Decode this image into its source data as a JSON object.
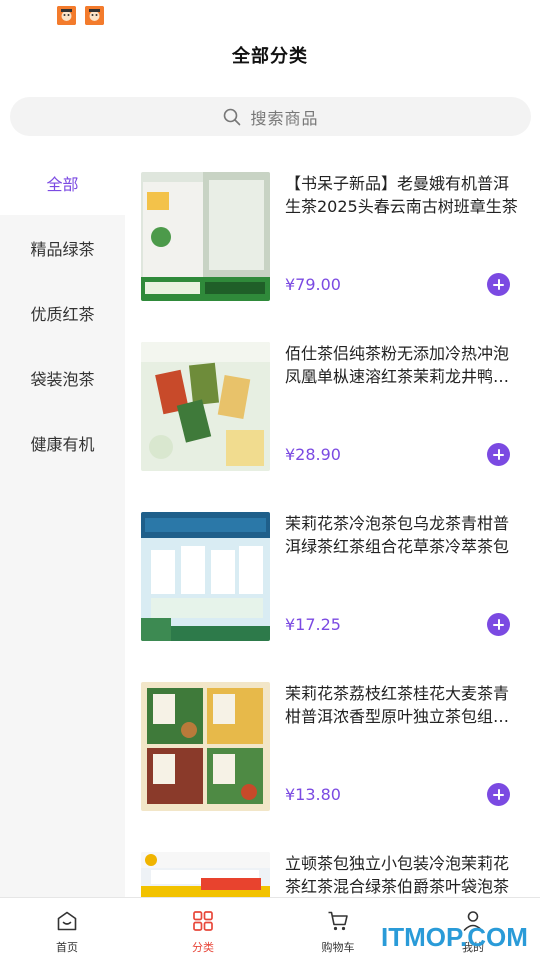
{
  "status_bar": {
    "icons": [
      "app-notification-icon",
      "app-notification-icon"
    ]
  },
  "header": {
    "title": "全部分类"
  },
  "search": {
    "placeholder": "搜索商品"
  },
  "sidebar": {
    "items": [
      {
        "label": "全部",
        "active": true
      },
      {
        "label": "精品绿茶",
        "active": false
      },
      {
        "label": "优质红茶",
        "active": false
      },
      {
        "label": "袋装泡茶",
        "active": false
      },
      {
        "label": "健康有机",
        "active": false
      }
    ]
  },
  "products": [
    {
      "title": "【书呆子新品】老曼娥有机普洱生茶2025头春云南古树班章生茶",
      "price": "¥79.00"
    },
    {
      "title": "佰仕茶侣纯茶粉无添加冷热冲泡凤凰单枞速溶红茶茉莉龙井鸭屎香",
      "price": "¥28.90"
    },
    {
      "title": "茉莉花茶冷泡茶包乌龙茶青柑普洱绿茶红茶组合花草茶冷萃茶包",
      "price": "¥17.25"
    },
    {
      "title": "茉莉花茶荔枝红茶桂花大麦茶青柑普洱浓香型原叶独立茶包组合装",
      "price": "¥13.80"
    },
    {
      "title": "立顿茶包独立小包装冷泡茉莉花茶红茶混合绿茶伯爵茶叶袋泡茶",
      "price": ""
    }
  ],
  "tabbar": {
    "tabs": [
      {
        "label": "首页",
        "icon": "home-icon"
      },
      {
        "label": "分类",
        "icon": "category-icon",
        "active": true
      },
      {
        "label": "购物车",
        "icon": "cart-icon"
      },
      {
        "label": "我的",
        "icon": "user-icon"
      }
    ]
  },
  "watermark": {
    "text": "ITMOP.COM"
  },
  "colors": {
    "accent": "#7b4ae2",
    "tab_active": "#e8473a",
    "watermark": "#2a9bd8"
  }
}
